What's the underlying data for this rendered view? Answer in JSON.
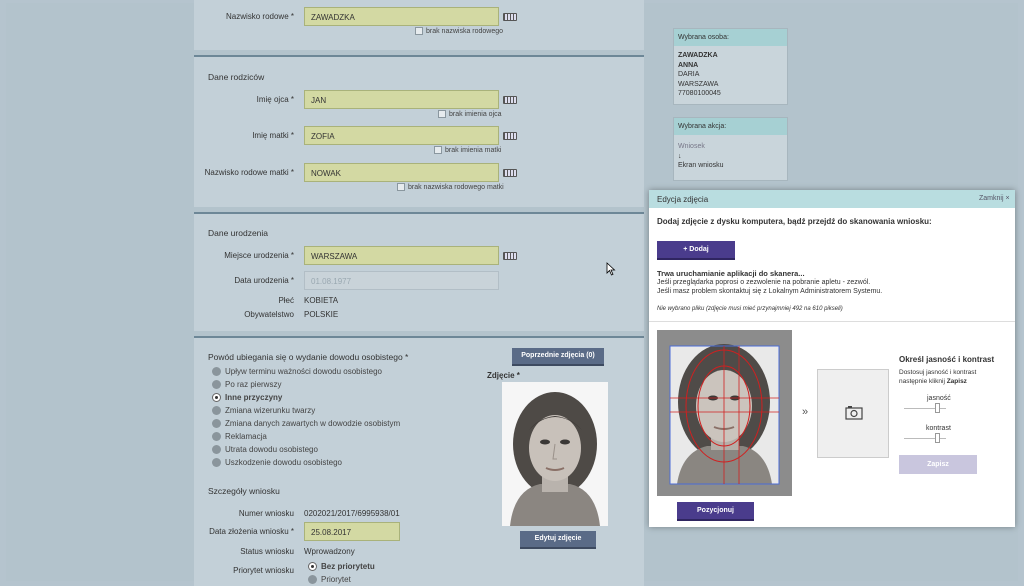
{
  "form": {
    "maiden_name": {
      "label": "Nazwisko rodowe *",
      "value": "ZAWADZKA",
      "checkbox": "brak nazwiska rodowego"
    },
    "parents": {
      "title": "Dane rodziców",
      "father": {
        "label": "Imię ojca *",
        "value": "JAN",
        "checkbox": "brak imienia ojca"
      },
      "mother": {
        "label": "Imię matki *",
        "value": "ZOFIA",
        "checkbox": "brak imienia matki"
      },
      "mother_maiden": {
        "label": "Nazwisko rodowe matki *",
        "value": "NOWAK",
        "checkbox": "brak nazwiska rodowego matki"
      }
    },
    "birth": {
      "title": "Dane urodzenia",
      "place": {
        "label": "Miejsce urodzenia *",
        "value": "WARSZAWA"
      },
      "date": {
        "label": "Data urodzenia *",
        "value": "01.08.1977"
      },
      "sex": {
        "label": "Płeć",
        "value": "KOBIETA"
      },
      "citizenship": {
        "label": "Obywatelstwo",
        "value": "POLSKIE"
      }
    },
    "reason": {
      "title": "Powód ubiegania się o wydanie dowodu osobistego *",
      "options": [
        "Upływ terminu ważności dowodu osobistego",
        "Po raz pierwszy",
        "Inne przyczyny",
        "Zmiana wizerunku twarzy",
        "Zmiana danych zawartych w dowodzie osobistym",
        "Reklamacja",
        "Utrata dowodu osobistego",
        "Uszkodzenie dowodu osobistego"
      ],
      "selected": "Inne przyczyny"
    },
    "photo": {
      "label": "Zdjęcie *",
      "prev_button": "Poprzednie zdjęcia (0)",
      "edit_button": "Edytuj zdjęcie"
    },
    "details": {
      "title": "Szczegóły wniosku",
      "number": {
        "label": "Numer wniosku",
        "value": "0202021/2017/6995938/01"
      },
      "date": {
        "label": "Data złożenia wniosku *",
        "value": "25.08.2017"
      },
      "status": {
        "label": "Status wniosku",
        "value": "Wprowadzony"
      },
      "priority": {
        "label": "Priorytet wniosku",
        "options": [
          "Bez priorytetu",
          "Priorytet"
        ],
        "selected": "Bez priorytetu"
      }
    }
  },
  "sidebar": {
    "person": {
      "title": "Wybrana osoba:",
      "lines": [
        "ZAWADZKA",
        "ANNA",
        "DARIA",
        "WARSZAWA",
        "77080100045"
      ]
    },
    "action": {
      "title": "Wybrana akcja:",
      "step1": "Wniosek",
      "arrow": "↓",
      "step2": "Ekran wniosku"
    }
  },
  "modal": {
    "title": "Edycja zdjęcia",
    "close": "Zamknij",
    "heading": "Dodaj zdjęcie z dysku komputera, bądź przejdź do skanowania wniosku:",
    "add_button": "+ Dodaj",
    "scan_title": "Trwa uruchamianie aplikacji do skanera...",
    "scan_line1": "Jeśli przeglądarka poprosi o zezwolenie na pobranie apletu - zezwól.",
    "scan_line2": "Jeśli masz problem skontaktuj się z Lokalnym Administratorem Systemu.",
    "file_note": "Nie wybrano pliku (zdjęcie musi mieć przynajmniej 492 na 610 pikseli)",
    "arrow": "»",
    "position_button": "Pozycjonuj",
    "adjust_title": "Określ jasność i kontrast",
    "adjust_line1": "Dostosuj jasność i kontrast",
    "adjust_line2_prefix": "następnie kliknij ",
    "adjust_line2_bold": "Zapisz",
    "brightness_label": "jasność",
    "contrast_label": "kontrast",
    "save_button": "Zapisz"
  },
  "colors": {
    "field_bg": "#d3d9a3",
    "button_purple": "#4a3c8c",
    "header_teal": "#a6d0d3"
  }
}
